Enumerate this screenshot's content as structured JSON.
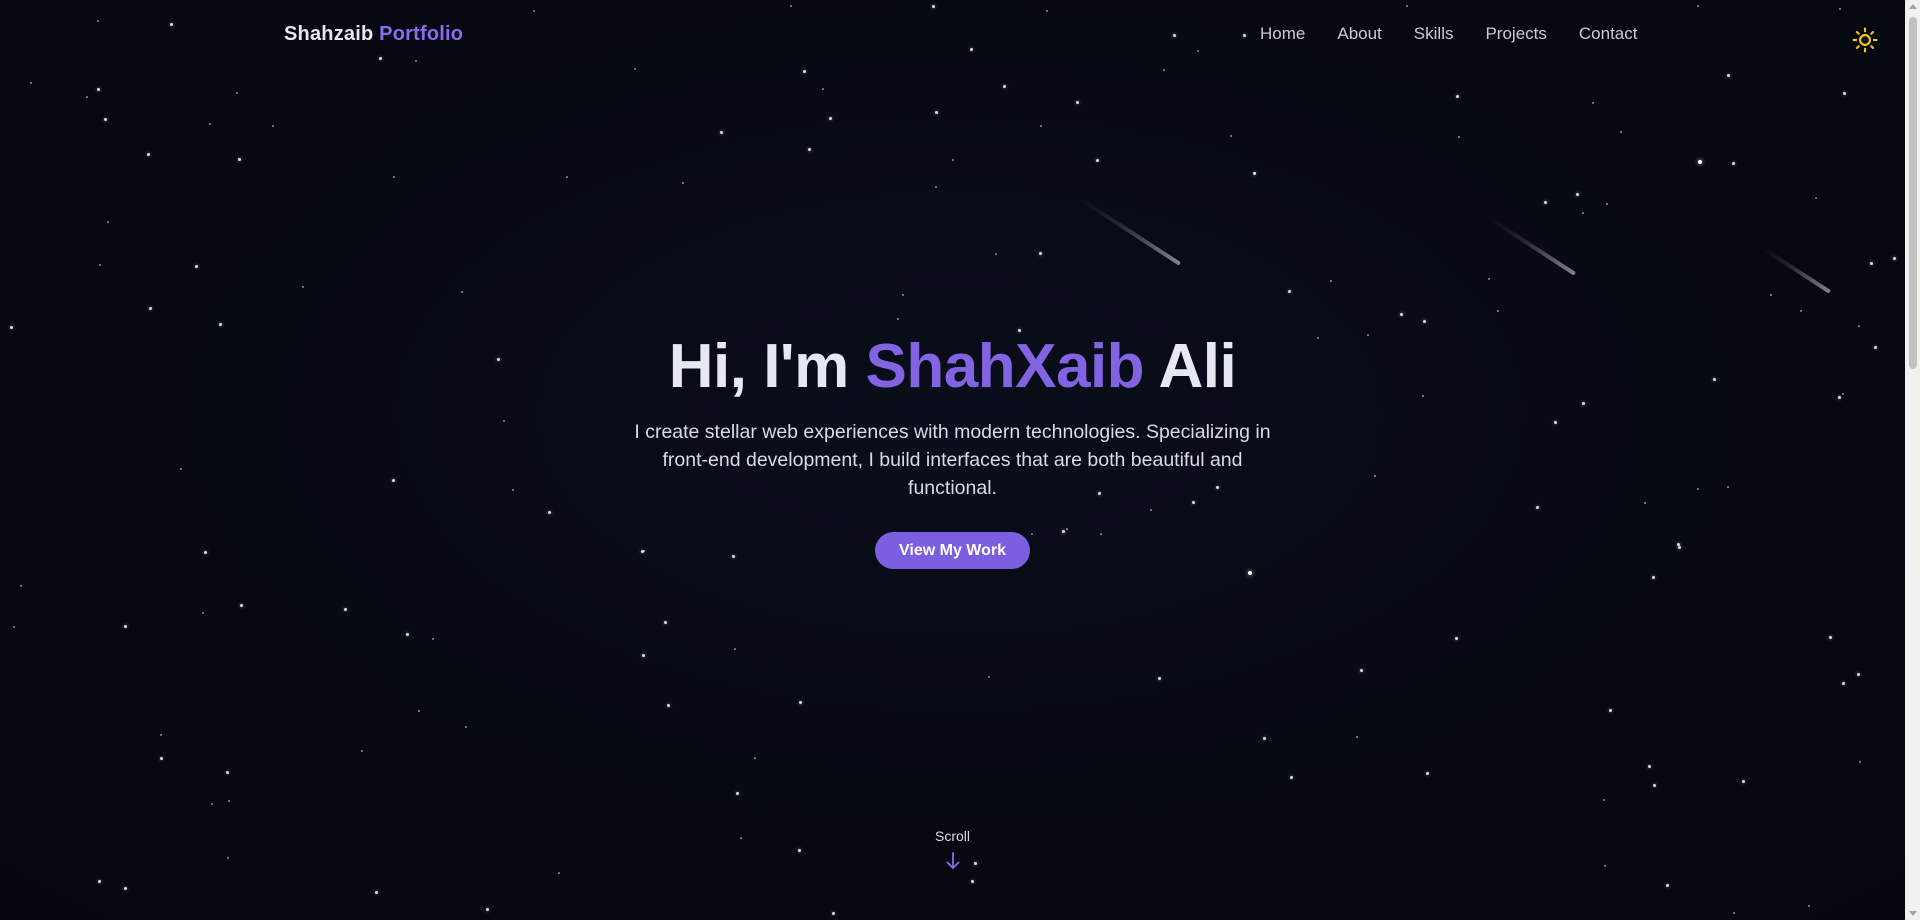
{
  "brand": {
    "first": "Shahzaib",
    "second": "Portfolio"
  },
  "nav": {
    "items": [
      {
        "label": "Home"
      },
      {
        "label": "About"
      },
      {
        "label": "Skills"
      },
      {
        "label": "Projects"
      },
      {
        "label": "Contact"
      }
    ]
  },
  "theme_toggle": {
    "icon": "sun-icon",
    "color": "#f5c518"
  },
  "hero": {
    "greeting": "Hi, I'm",
    "name": "ShahXaib",
    "surname": "Ali",
    "description": "I create stellar web experiences with modern technologies. Specializing in front-end development, I build interfaces that are both beautiful and functional.",
    "cta_label": "View My Work"
  },
  "scroll_indicator": {
    "label": "Scroll",
    "icon": "arrow-down-icon"
  },
  "colors": {
    "background": "#060912",
    "accent": "#8264e3",
    "button": "#7c5fe0",
    "text": "#e6e8f2"
  }
}
